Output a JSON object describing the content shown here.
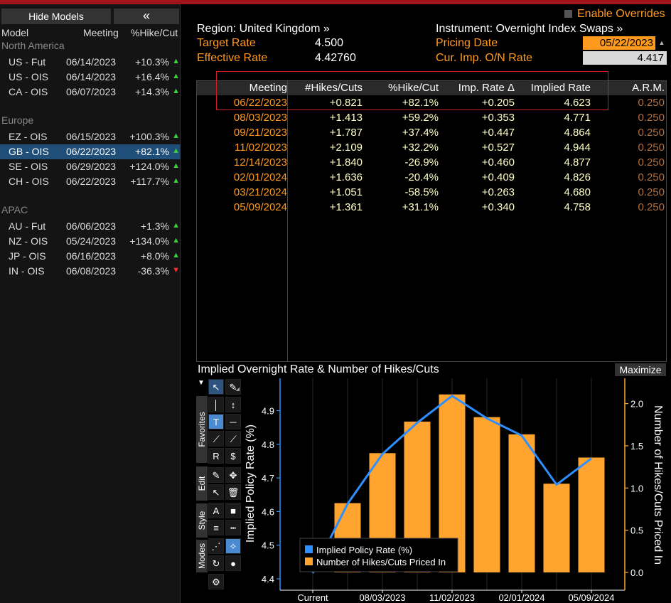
{
  "left_panel": {
    "hide_label": "Hide Models",
    "collapse_label": "«",
    "headers": {
      "model": "Model",
      "meeting": "Meeting",
      "hike": "%Hike/Cut"
    },
    "groups": [
      {
        "name": "North America",
        "rows": [
          {
            "model": "US - Fut",
            "meeting": "06/14/2023",
            "hike": "+10.3%",
            "dir": "up"
          },
          {
            "model": "US - OIS",
            "meeting": "06/14/2023",
            "hike": "+16.4%",
            "dir": "up"
          },
          {
            "model": "CA - OIS",
            "meeting": "06/07/2023",
            "hike": "+14.3%",
            "dir": "up"
          }
        ]
      },
      {
        "name": "Europe",
        "rows": [
          {
            "model": "EZ - OIS",
            "meeting": "06/15/2023",
            "hike": "+100.3%",
            "dir": "up"
          },
          {
            "model": "GB - OIS",
            "meeting": "06/22/2023",
            "hike": "+82.1%",
            "dir": "up",
            "selected": true
          },
          {
            "model": "SE - OIS",
            "meeting": "06/29/2023",
            "hike": "+124.0%",
            "dir": "up"
          },
          {
            "model": "CH - OIS",
            "meeting": "06/22/2023",
            "hike": "+117.7%",
            "dir": "up"
          }
        ]
      },
      {
        "name": "APAC",
        "rows": [
          {
            "model": "AU - Fut",
            "meeting": "06/06/2023",
            "hike": "+1.3%",
            "dir": "up"
          },
          {
            "model": "NZ - OIS",
            "meeting": "05/24/2023",
            "hike": "+134.0%",
            "dir": "up"
          },
          {
            "model": "JP - OIS",
            "meeting": "06/16/2023",
            "hike": "+8.0%",
            "dir": "up"
          },
          {
            "model": "IN - OIS",
            "meeting": "06/08/2023",
            "hike": "-36.3%",
            "dir": "down"
          }
        ]
      }
    ]
  },
  "header": {
    "enable_overrides": "Enable Overrides",
    "region": "Region: United Kingdom »",
    "instrument": "Instrument: Overnight Index Swaps »",
    "target_rate_label": "Target Rate",
    "target_rate_value": "4.500",
    "effective_rate_label": "Effective Rate",
    "effective_rate_value": "4.42760",
    "pricing_date_label": "Pricing Date",
    "pricing_date_value": "05/22/2023",
    "cur_imp_label": "Cur. Imp. O/N Rate",
    "cur_imp_value": "4.417"
  },
  "table": {
    "headers": [
      "Meeting",
      "#Hikes/Cuts",
      "%Hike/Cut",
      "Imp. Rate Δ",
      "Implied Rate",
      "A.R.M."
    ],
    "rows": [
      [
        "06/22/2023",
        "+0.821",
        "+82.1%",
        "+0.205",
        "4.623",
        "0.250"
      ],
      [
        "08/03/2023",
        "+1.413",
        "+59.2%",
        "+0.353",
        "4.771",
        "0.250"
      ],
      [
        "09/21/2023",
        "+1.787",
        "+37.4%",
        "+0.447",
        "4.864",
        "0.250"
      ],
      [
        "11/02/2023",
        "+2.109",
        "+32.2%",
        "+0.527",
        "4.944",
        "0.250"
      ],
      [
        "12/14/2023",
        "+1.840",
        "-26.9%",
        "+0.460",
        "4.877",
        "0.250"
      ],
      [
        "02/01/2024",
        "+1.636",
        "-20.4%",
        "+0.409",
        "4.826",
        "0.250"
      ],
      [
        "03/21/2024",
        "+1.051",
        "-58.5%",
        "+0.263",
        "4.680",
        "0.250"
      ],
      [
        "05/09/2024",
        "+1.361",
        "+31.1%",
        "+0.340",
        "4.758",
        "0.250"
      ]
    ]
  },
  "chart": {
    "title": "Implied Overnight Rate & Number of Hikes/Cuts",
    "maximize_label": "Maximize",
    "tabs": [
      "Favorites",
      "Edit",
      "Style",
      "Modes"
    ]
  },
  "chart_data": {
    "type": "bar",
    "title": "Implied Overnight Rate & Number of Hikes/Cuts",
    "categories": [
      "Current",
      "06/22/2023",
      "08/03/2023",
      "09/21/2023",
      "11/02/2023",
      "12/14/2023",
      "02/01/2024",
      "03/21/2024",
      "05/09/2024"
    ],
    "x_tick_labels": [
      "Current",
      "08/03/2023",
      "11/02/2023",
      "02/01/2024",
      "05/09/2024"
    ],
    "ylabel": "Implied Policy Rate (%)",
    "y2label": "Number of Hikes/Cuts Priced In",
    "ylim": [
      4.4,
      4.95
    ],
    "y2lim": [
      0,
      2.2
    ],
    "yticks": [
      4.4,
      4.5,
      4.6,
      4.7,
      4.8,
      4.9
    ],
    "y2ticks": [
      0.0,
      0.5,
      1.0,
      1.5,
      2.0
    ],
    "legend_position": "bottom-left",
    "colors": {
      "line": "#2f8fff",
      "bars": "#ffa42e"
    },
    "series": [
      {
        "name": "Implied Policy Rate (%)",
        "type": "line",
        "axis": "left",
        "values": [
          4.417,
          4.623,
          4.771,
          4.864,
          4.944,
          4.877,
          4.826,
          4.68,
          4.758
        ]
      },
      {
        "name": "Number of Hikes/Cuts Priced In",
        "type": "bar",
        "axis": "right",
        "values": [
          null,
          0.821,
          1.413,
          1.787,
          2.109,
          1.84,
          1.636,
          1.051,
          1.361
        ]
      }
    ]
  }
}
